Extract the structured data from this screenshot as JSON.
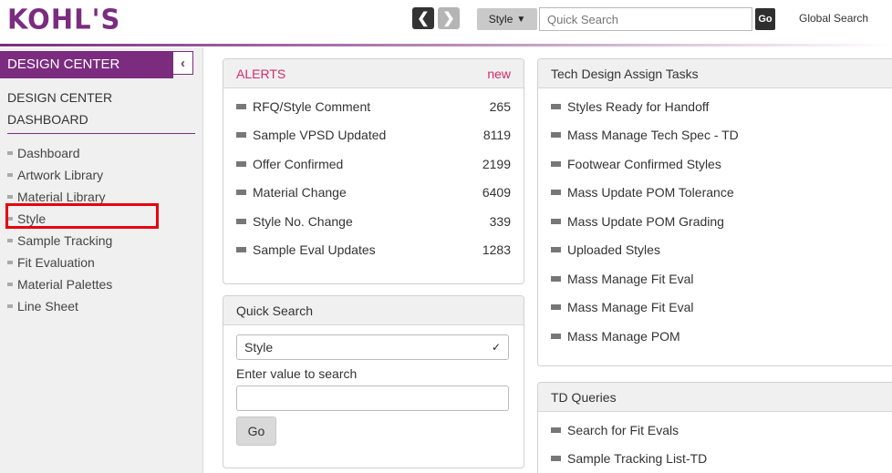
{
  "header": {
    "logo": "KOHL'S",
    "search_type": "Style",
    "search_placeholder": "Quick Search",
    "go_label": "Go",
    "global_search_label": "Global Search"
  },
  "sidebar": {
    "heading": "DESIGN CENTER",
    "title_line1": "DESIGN CENTER",
    "title_line2": "DASHBOARD",
    "items": [
      {
        "label": "Dashboard"
      },
      {
        "label": "Artwork Library"
      },
      {
        "label": "Material Library"
      },
      {
        "label": "Style"
      },
      {
        "label": "Sample Tracking"
      },
      {
        "label": "Fit Evaluation"
      },
      {
        "label": "Material Palettes"
      },
      {
        "label": "Line Sheet"
      }
    ],
    "highlighted_item": "Style"
  },
  "alerts": {
    "title": "ALERTS",
    "new_label": "new",
    "rows": [
      {
        "label": "RFQ/Style Comment",
        "count": "265"
      },
      {
        "label": "Sample VPSD Updated",
        "count": "8119"
      },
      {
        "label": "Offer Confirmed",
        "count": "2199"
      },
      {
        "label": "Material Change",
        "count": "6409"
      },
      {
        "label": "Style No. Change",
        "count": "339"
      },
      {
        "label": "Sample Eval Updates",
        "count": "1283"
      }
    ]
  },
  "quick_search": {
    "title": "Quick Search",
    "select_value": "Style",
    "input_label": "Enter value to search",
    "input_value": "",
    "go_label": "Go"
  },
  "tech_design": {
    "title": "Tech Design Assign Tasks",
    "items": [
      {
        "label": "Styles Ready for Handoff"
      },
      {
        "label": "Mass Manage Tech Spec - TD"
      },
      {
        "label": "Footwear Confirmed Styles"
      },
      {
        "label": "Mass Update POM Tolerance"
      },
      {
        "label": "Mass Update POM Grading"
      },
      {
        "label": "Uploaded Styles"
      },
      {
        "label": "Mass Manage Fit Eval"
      },
      {
        "label": "Mass Manage Fit Eval"
      },
      {
        "label": "Mass Manage POM"
      }
    ]
  },
  "td_queries": {
    "title": "TD Queries",
    "items": [
      {
        "label": "Search for Fit Evals"
      },
      {
        "label": "Sample Tracking List-TD"
      }
    ]
  },
  "colors": {
    "brand": "#7b2c7f",
    "alert": "#d12b6d",
    "highlight": "#e8000d"
  }
}
